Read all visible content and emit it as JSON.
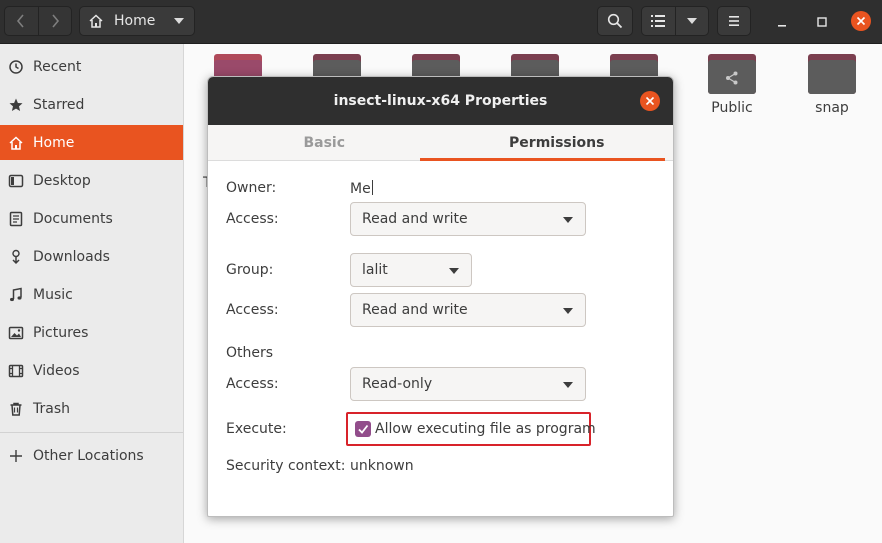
{
  "toolbar": {
    "path_label": "Home",
    "icons": [
      "go-back-icon",
      "go-forward-icon",
      "home-icon",
      "search-icon",
      "list-view-icon",
      "menu-icon",
      "minimize-icon",
      "maximize-icon",
      "close-icon"
    ]
  },
  "sidebar": {
    "items": [
      {
        "label": "Recent",
        "icon": "clock-icon"
      },
      {
        "label": "Starred",
        "icon": "star-icon"
      },
      {
        "label": "Home",
        "icon": "home-icon",
        "active": true
      },
      {
        "label": "Desktop",
        "icon": "desktop-icon"
      },
      {
        "label": "Documents",
        "icon": "documents-icon"
      },
      {
        "label": "Downloads",
        "icon": "download-icon"
      },
      {
        "label": "Music",
        "icon": "music-icon"
      },
      {
        "label": "Pictures",
        "icon": "pictures-icon"
      },
      {
        "label": "Videos",
        "icon": "videos-icon"
      },
      {
        "label": "Trash",
        "icon": "trash-icon"
      },
      {
        "label": "Other Locations",
        "icon": "plus-icon"
      }
    ]
  },
  "files": {
    "visible_labels": [
      "Public",
      "snap"
    ]
  },
  "dialog": {
    "title": "insect-linux-x64 Properties",
    "tabs": [
      "Basic",
      "Permissions"
    ],
    "active_tab": "Permissions",
    "owner_label": "Owner:",
    "owner_value": "Me",
    "owner_access_label": "Access:",
    "owner_access_value": "Read and write",
    "group_label": "Group:",
    "group_value": "lalit",
    "group_access_label": "Access:",
    "group_access_value": "Read and write",
    "others_label": "Others",
    "others_access_label": "Access:",
    "others_access_value": "Read-only",
    "execute_label": "Execute:",
    "execute_checkbox_label": "Allow executing file as program",
    "execute_checked": true,
    "security_label": "Security context:",
    "security_value": "unknown"
  },
  "colors": {
    "accent": "#e95420",
    "headerbar": "#2f2f2f",
    "checkbox": "#924d8b",
    "highlight_border": "#d8232a"
  }
}
